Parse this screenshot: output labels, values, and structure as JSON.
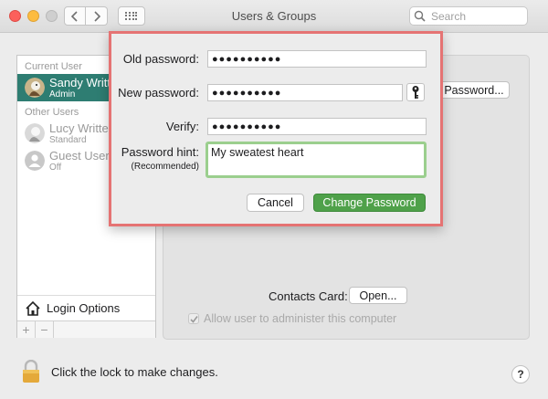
{
  "window": {
    "title": "Users & Groups",
    "search_placeholder": "Search"
  },
  "users": {
    "current_label": "Current User",
    "other_label": "Other Users",
    "current": {
      "name": "Sandy Writter",
      "role": "Admin"
    },
    "others": [
      {
        "name": "Lucy Writter",
        "role": "Standard"
      },
      {
        "name": "Guest User",
        "role": "Off"
      }
    ],
    "login_options": "Login Options",
    "add": "+",
    "remove": "−"
  },
  "details": {
    "change_password_button": "Password...",
    "contacts_card_label": "Contacts Card:",
    "open_button": "Open...",
    "admin_checkbox_label": "Allow user to administer this computer",
    "admin_checked": true
  },
  "footer": {
    "lock_text": "Click the lock to make changes.",
    "help": "?"
  },
  "sheet": {
    "old_password_label": "Old password:",
    "old_password_value": "●●●●●●●●●●",
    "new_password_label": "New password:",
    "new_password_value": "●●●●●●●●●●",
    "verify_label": "Verify:",
    "verify_value": "●●●●●●●●●●",
    "hint_label": "Password hint:",
    "hint_sublabel": "(Recommended)",
    "hint_value": "My sweatest heart",
    "cancel_button": "Cancel",
    "change_button": "Change Password"
  },
  "colors": {
    "selection": "#2e7d72",
    "highlight_border": "#e57373",
    "hint_focus": "#9bcf8e",
    "primary_button": "#4fa14a"
  }
}
